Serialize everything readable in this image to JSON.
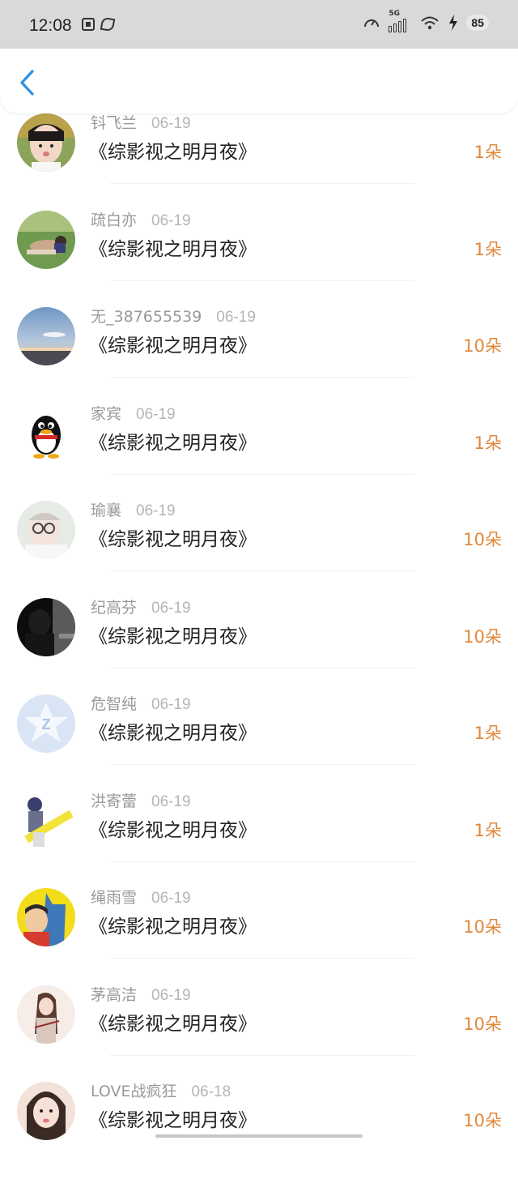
{
  "status_bar": {
    "time": "12:08",
    "network": "5G",
    "battery": "85",
    "icons": [
      "notification-square-icon",
      "leaf-icon",
      "speedometer-icon",
      "signal-icon",
      "wifi-icon",
      "charging-bolt-icon",
      "battery-icon"
    ]
  },
  "nav": {
    "back_icon": "chevron-left-icon",
    "accent_color": "#2f8fe0"
  },
  "colors": {
    "amount": "#e0883a",
    "name": "#999999",
    "date": "#b5b5b5",
    "work": "#222222"
  },
  "gifts": [
    {
      "name": "钭飞兰",
      "date": "06-19",
      "work": "《综影视之明月夜》",
      "amount": "1朵",
      "avatar": "child-photo"
    },
    {
      "name": "疏白亦",
      "date": "06-19",
      "work": "《综影视之明月夜》",
      "amount": "1朵",
      "avatar": "grass-photo"
    },
    {
      "name": "无_387655539",
      "date": "06-19",
      "work": "《综影视之明月夜》",
      "amount": "10朵",
      "avatar": "sky-photo"
    },
    {
      "name": "家宾",
      "date": "06-19",
      "work": "《综影视之明月夜》",
      "amount": "1朵",
      "avatar": "penguin"
    },
    {
      "name": "瑜襄",
      "date": "06-19",
      "work": "《综影视之明月夜》",
      "amount": "10朵",
      "avatar": "baby-photo"
    },
    {
      "name": "纪高芬",
      "date": "06-19",
      "work": "《综影视之明月夜》",
      "amount": "10朵",
      "avatar": "dark-photo"
    },
    {
      "name": "危智纯",
      "date": "06-19",
      "work": "《综影视之明月夜》",
      "amount": "1朵",
      "avatar": "default-z"
    },
    {
      "name": "洪寄蕾",
      "date": "06-19",
      "work": "《综影视之明月夜》",
      "amount": "1朵",
      "avatar": "banner-photo"
    },
    {
      "name": "绳雨雪",
      "date": "06-19",
      "work": "《综影视之明月夜》",
      "amount": "10朵",
      "avatar": "comic-photo"
    },
    {
      "name": "茅高洁",
      "date": "06-19",
      "work": "《综影视之明月夜》",
      "amount": "10朵",
      "avatar": "drawing-photo"
    },
    {
      "name": "LOVE战疯狂",
      "date": "06-18",
      "work": "《综影视之明月夜》",
      "amount": "10朵",
      "avatar": "girl-photo"
    }
  ]
}
